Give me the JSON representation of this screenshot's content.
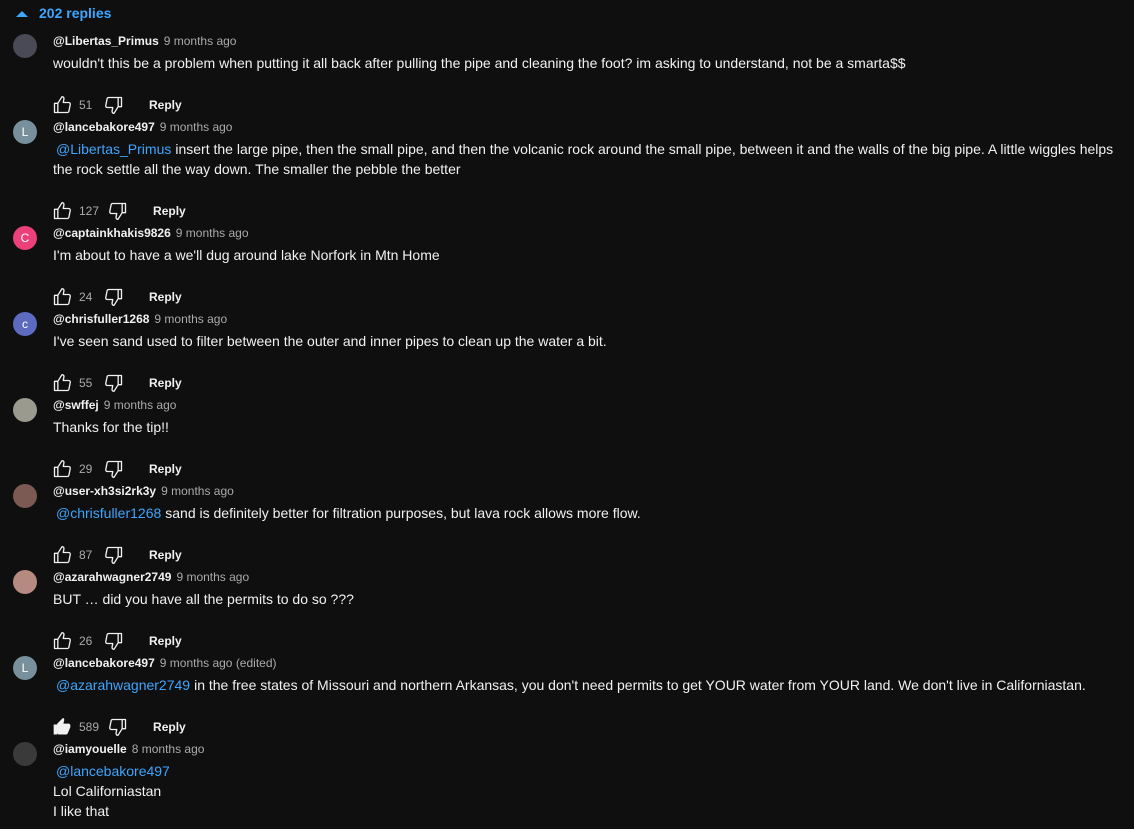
{
  "thread": {
    "toggle_label": "202 replies"
  },
  "ui": {
    "reply_label": "Reply"
  },
  "colors": {
    "link": "#3ea6ff",
    "secondary_text": "#aaaaaa",
    "background": "#0f0f0f"
  },
  "comments": [
    {
      "author": "@Libertas_Primus",
      "time": "9 months ago",
      "mention": "",
      "lines": [
        "wouldn't this be a problem when putting it all back after pulling the pipe and cleaning the foot? im asking to understand, not be a smarta$$"
      ],
      "likes": "51",
      "liked": false,
      "avatar_letter": "",
      "avatar_color": "#4a4a56"
    },
    {
      "author": "@lancebakore497",
      "time": "9 months ago",
      "mention": "@Libertas_Primus",
      "lines": [
        "insert the large pipe, then the small pipe, and then the volcanic rock around the small pipe, between it and the walls of the big pipe. A little wiggles helps the rock settle all the way down. The smaller the pebble the better"
      ],
      "likes": "127",
      "liked": false,
      "avatar_letter": "L",
      "avatar_color": "#78909c"
    },
    {
      "author": "@captainkhakis9826",
      "time": "9 months ago",
      "mention": "",
      "lines": [
        "I'm about to have a we'll dug around lake Norfork in Mtn Home"
      ],
      "likes": "24",
      "liked": false,
      "avatar_letter": "C",
      "avatar_color": "#ec407a"
    },
    {
      "author": "@chrisfuller1268",
      "time": "9 months ago",
      "mention": "",
      "lines": [
        "I've seen sand used to filter between the outer and inner pipes to clean up the water a bit."
      ],
      "likes": "55",
      "liked": false,
      "avatar_letter": "c",
      "avatar_color": "#5c6bc0"
    },
    {
      "author": "@swffej",
      "time": "9 months ago",
      "mention": "",
      "lines": [
        "Thanks for the tip!!"
      ],
      "likes": "29",
      "liked": false,
      "avatar_letter": "",
      "avatar_color": "#9a9a8e"
    },
    {
      "author": "@user-xh3si2rk3y",
      "time": "9 months ago",
      "mention": "@chrisfuller1268",
      "lines": [
        "sand is definitely better for filtration purposes, but lava rock allows more flow."
      ],
      "likes": "87",
      "liked": false,
      "avatar_letter": "",
      "avatar_color": "#7a5a52"
    },
    {
      "author": "@azarahwagner2749",
      "time": "9 months ago",
      "mention": "",
      "lines": [
        "BUT … did you have all the permits to do so ???"
      ],
      "likes": "26",
      "liked": false,
      "avatar_letter": "",
      "avatar_color": "#b58a80"
    },
    {
      "author": "@lancebakore497",
      "time": "9 months ago (edited)",
      "mention": "@azarahwagner2749",
      "lines": [
        "in the free states of Missouri and northern Arkansas, you don't need permits to get YOUR  water from YOUR land. We don't live in Californiastan."
      ],
      "likes": "589",
      "liked": true,
      "avatar_letter": "L",
      "avatar_color": "#78909c"
    },
    {
      "author": "@iamyouelle",
      "time": "8 months ago",
      "mention": "@lancebakore497",
      "lines": [
        "Lol Californiastan",
        "I like that"
      ],
      "likes": "",
      "liked": false,
      "avatar_letter": "",
      "avatar_color": "#3a3a3a"
    }
  ]
}
